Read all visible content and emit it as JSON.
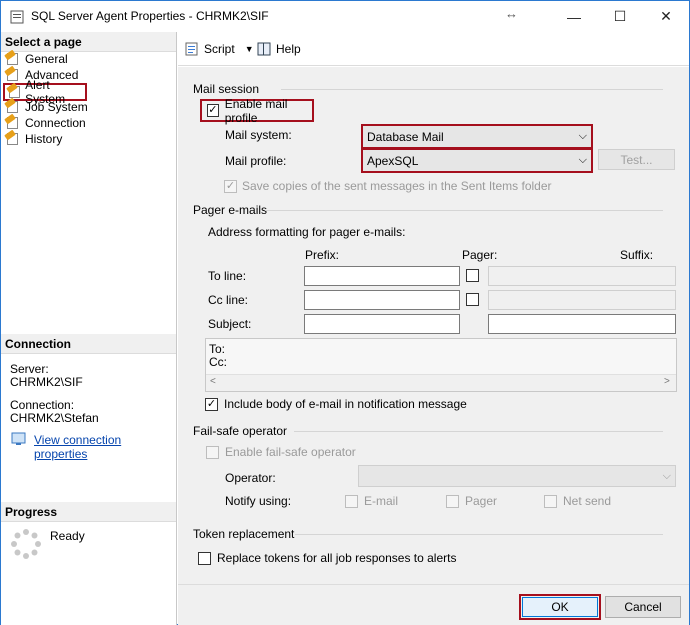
{
  "window": {
    "title": "SQL Server Agent Properties - CHRMK2\\SIF",
    "min_glyph": "—",
    "max_glyph": "☐",
    "close_glyph": "✕",
    "resize_glyph": "↔"
  },
  "left": {
    "select_page_header": "Select a page",
    "pages": [
      "General",
      "Advanced",
      "Alert System",
      "Job System",
      "Connection",
      "History"
    ],
    "connection_header": "Connection",
    "server_label": "Server:",
    "server_value": "CHRMK2\\SIF",
    "connection_label": "Connection:",
    "connection_value": "CHRMK2\\Stefan",
    "view_props_link": "View connection properties",
    "progress_header": "Progress",
    "progress_status": "Ready"
  },
  "toolbar": {
    "script_label": "Script",
    "help_label": "Help"
  },
  "mail_session": {
    "group_label": "Mail session",
    "enable_label": "Enable mail profile",
    "enable_checked": "✓",
    "mail_system_label": "Mail system:",
    "mail_system_value": "Database Mail",
    "mail_profile_label": "Mail profile:",
    "mail_profile_value": "ApexSQL",
    "test_label": "Test...",
    "save_copies_label": "Save copies of the sent messages in the Sent Items folder",
    "save_copies_checked": "✓"
  },
  "pager": {
    "group_label": "Pager e-mails",
    "address_format_label": "Address formatting for pager e-mails:",
    "prefix_header": "Prefix:",
    "pager_header": "Pager:",
    "suffix_header": "Suffix:",
    "to_line_label": "To line:",
    "cc_line_label": "Cc line:",
    "subject_label": "Subject:",
    "preview_to": "To:",
    "preview_cc": "Cc:",
    "include_body_label": "Include body of e-mail in notification message",
    "include_body_checked": "✓"
  },
  "failsafe": {
    "group_label": "Fail-safe operator",
    "enable_label": "Enable fail-safe operator",
    "operator_label": "Operator:",
    "notify_label": "Notify using:",
    "email_label": "E-mail",
    "pager_label": "Pager",
    "netsend_label": "Net send"
  },
  "tokens": {
    "group_label": "Token replacement",
    "replace_label": "Replace tokens for all job responses to alerts"
  },
  "buttons": {
    "ok_label": "OK",
    "cancel_label": "Cancel"
  },
  "colors": {
    "highlight_red": "#a50f1d",
    "link_blue": "#0645ad"
  }
}
